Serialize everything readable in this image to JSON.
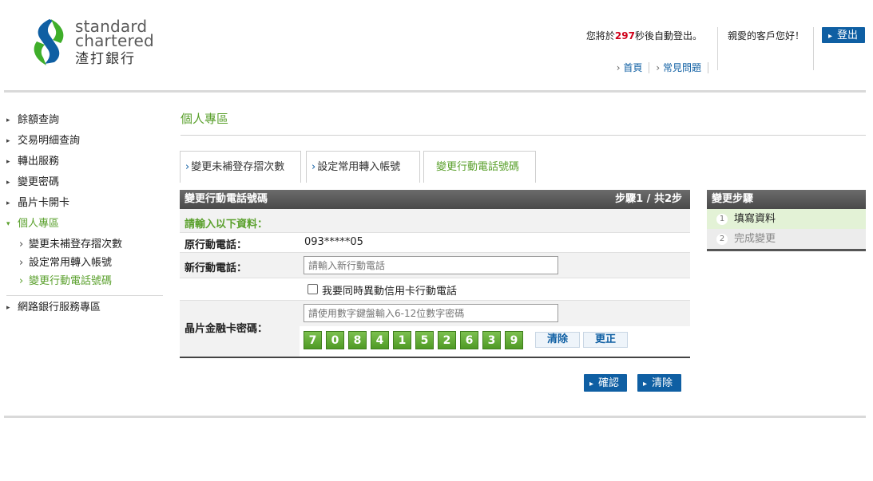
{
  "brand": {
    "name_line1": "standard",
    "name_line2": "chartered",
    "name_zh": "渣打銀行",
    "colors": {
      "blue": "#0f5fa3",
      "green": "#5aa02c"
    }
  },
  "header": {
    "logout_prefix": "您將於",
    "logout_seconds": "297",
    "logout_suffix": "秒後自動登出。",
    "greeting": "親愛的客戶您好！",
    "logout_button": "登出",
    "links": [
      "首頁",
      "常見問題"
    ]
  },
  "sidebar": {
    "items": [
      {
        "label": "餘額查詢"
      },
      {
        "label": "交易明細查詢"
      },
      {
        "label": "轉出服務"
      },
      {
        "label": "變更密碼"
      },
      {
        "label": "晶片卡開卡"
      },
      {
        "label": "個人專區"
      }
    ],
    "subitems": [
      {
        "label": "變更未補登存摺次數"
      },
      {
        "label": "設定常用轉入帳號"
      },
      {
        "label": "變更行動電話號碼"
      }
    ],
    "bottom_item": "網路銀行服務專區"
  },
  "main": {
    "page_title": "個人專區",
    "tabs": [
      {
        "label": "變更未補登存摺次數"
      },
      {
        "label": "設定常用轉入帳號"
      },
      {
        "label": "變更行動電話號碼"
      }
    ],
    "form": {
      "title": "變更行動電話號碼",
      "step_text": "步驟1 / 共2步",
      "instruction": "請輸入以下資料：",
      "old_phone_label": "原行動電話：",
      "old_phone_value": "093*****05",
      "new_phone_label": "新行動電話：",
      "new_phone_placeholder": "請輸入新行動電話",
      "checkbox_label": "我要同時異動信用卡行動電話",
      "pin_label": "晶片金融卡密碼：",
      "pin_placeholder": "請使用數字鍵盤輸入6-12位數字密碼",
      "keypad_digits": [
        "7",
        "0",
        "8",
        "4",
        "1",
        "5",
        "2",
        "6",
        "3",
        "9"
      ],
      "clear_key": "清除",
      "correct_key": "更正",
      "confirm_button": "確認",
      "clear_button": "清除"
    }
  },
  "steps": {
    "title": "變更步驟",
    "items": [
      {
        "num": "1",
        "label": "填寫資料"
      },
      {
        "num": "2",
        "label": "完成變更"
      }
    ]
  }
}
